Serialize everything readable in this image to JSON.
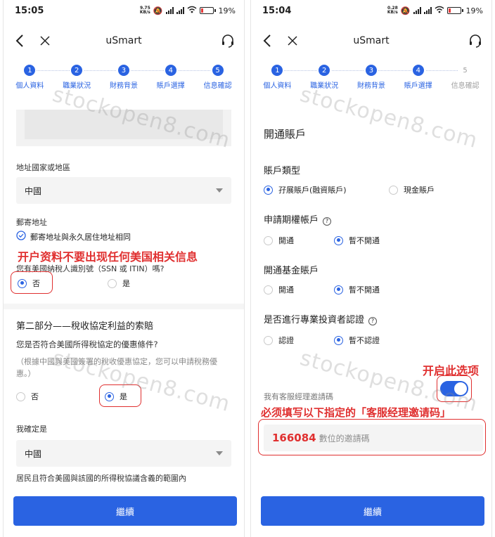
{
  "left": {
    "status": {
      "time": "15:05",
      "speed_value": "9.75",
      "speed_unit": "KB/s",
      "battery": "19"
    },
    "nav": {
      "title": "uSmart"
    },
    "steps": [
      {
        "num": "1",
        "label": "個人資料"
      },
      {
        "num": "2",
        "label": "職業狀況"
      },
      {
        "num": "3",
        "label": "財務背景"
      },
      {
        "num": "4",
        "label": "賬戶選擇"
      },
      {
        "num": "5",
        "label": "信息確認"
      }
    ],
    "address_country_label": "地址國家或地區",
    "address_country_value": "中國",
    "mail_address_label": "郵寄地址",
    "mail_same_label": "郵寄地址與永久居住地址相同",
    "annotation_no_us": "开户资料不要出现任何美国相关信息",
    "tin_question": "您有美國納稅人識別號（SSN 或 ITIN）嗎?",
    "tin_options": [
      "否",
      "是"
    ],
    "part2_title": "第二部分——稅收協定利益的索賠",
    "treaty_question": "您是否符合美國所得稅協定的優惠條件?",
    "treaty_note": "（根據中國與美國簽署的稅收優惠協定，您可以申請稅務優惠。）",
    "treaty_options": [
      "否",
      "是"
    ],
    "confirm_label": "我確定是",
    "confirm_value": "中國",
    "resident_text": "居民且符合美國與該國的所得稅協議含義的範圍內",
    "continue_button": "繼續",
    "watermark": "stockopen8.com"
  },
  "right": {
    "status": {
      "time": "15:04",
      "speed_value": "0.28",
      "speed_unit": "KB/s",
      "battery": "19"
    },
    "nav": {
      "title": "uSmart"
    },
    "steps": [
      {
        "num": "1",
        "label": "個人資料"
      },
      {
        "num": "2",
        "label": "職業狀況"
      },
      {
        "num": "3",
        "label": "財務背景"
      },
      {
        "num": "4",
        "label": "賬戶選擇"
      },
      {
        "num": "5",
        "label": "信息確認"
      }
    ],
    "open_account_title": "開通賬戶",
    "account_type_label": "賬戶類型",
    "account_type_options": [
      "孖展賬戶(融資賬戶)",
      "現金賬戶"
    ],
    "options_label": "申請期權帳戶",
    "options_options": [
      "開通",
      "暫不開通"
    ],
    "fund_label": "開通基金賬戶",
    "fund_options": [
      "開通",
      "暫不開通"
    ],
    "pro_label": "是否進行專業投資者認證",
    "pro_options": [
      "認證",
      "暫不認證"
    ],
    "annotation_toggle": "开启此选项",
    "referral_label": "我有客服經理邀請碼",
    "annotation_fill": "必须填写以下指定的「客服经理邀请码」",
    "invite_code": "166084",
    "invite_placeholder": "數位的邀請碼",
    "continue_button": "繼續",
    "watermark": "stockopen8.com"
  },
  "colors": {
    "accent": "#2a63e2",
    "annotation": "#e03030"
  }
}
